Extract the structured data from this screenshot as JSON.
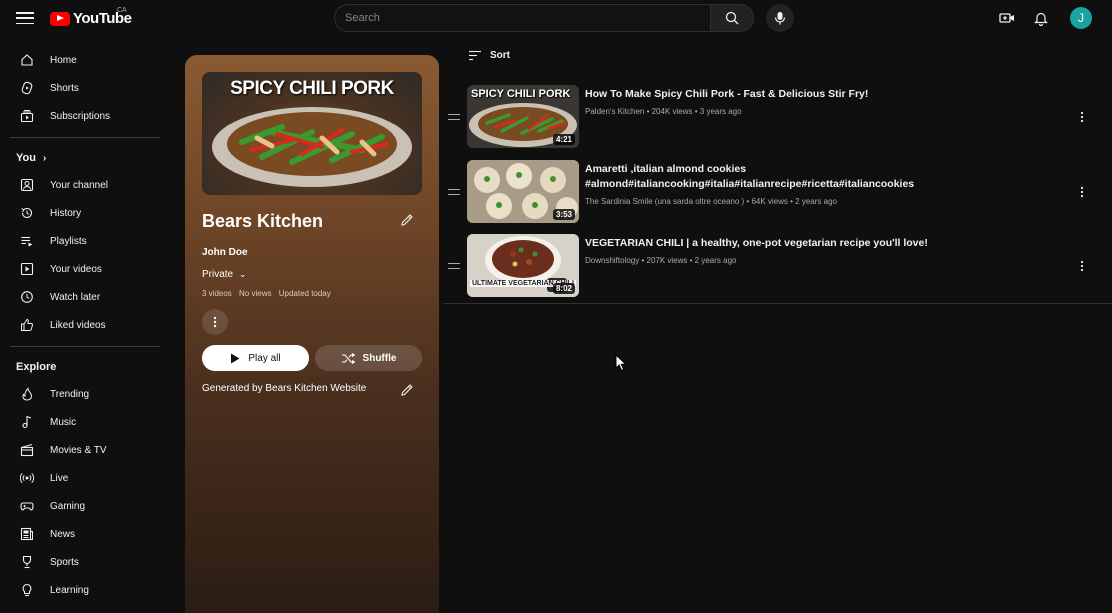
{
  "header": {
    "logo_text": "YouTube",
    "region": "CA",
    "search_placeholder": "Search",
    "avatar_letter": "J"
  },
  "sidebar": {
    "main": [
      {
        "label": "Home",
        "icon": "home-icon"
      },
      {
        "label": "Shorts",
        "icon": "shorts-icon"
      },
      {
        "label": "Subscriptions",
        "icon": "subscriptions-icon"
      }
    ],
    "you_heading": "You",
    "you": [
      {
        "label": "Your channel",
        "icon": "channel-icon"
      },
      {
        "label": "History",
        "icon": "history-icon"
      },
      {
        "label": "Playlists",
        "icon": "playlists-icon"
      },
      {
        "label": "Your videos",
        "icon": "your-videos-icon"
      },
      {
        "label": "Watch later",
        "icon": "watch-later-icon"
      },
      {
        "label": "Liked videos",
        "icon": "liked-icon"
      }
    ],
    "explore_heading": "Explore",
    "explore": [
      {
        "label": "Trending",
        "icon": "trending-icon"
      },
      {
        "label": "Music",
        "icon": "music-icon"
      },
      {
        "label": "Movies & TV",
        "icon": "movies-icon"
      },
      {
        "label": "Live",
        "icon": "live-icon"
      },
      {
        "label": "Gaming",
        "icon": "gaming-icon"
      },
      {
        "label": "News",
        "icon": "news-icon"
      },
      {
        "label": "Sports",
        "icon": "sports-icon"
      },
      {
        "label": "Learning",
        "icon": "learning-icon"
      }
    ]
  },
  "playlist": {
    "thumb_caption": "SPICY CHILI PORK",
    "title": "Bears Kitchen",
    "owner": "John Doe",
    "privacy": "Private",
    "video_count": "3 videos",
    "views": "No views",
    "updated": "Updated today",
    "play_all": "Play all",
    "shuffle": "Shuffle",
    "description": "Generated by Bears Kitchen Website"
  },
  "sort_label": "Sort",
  "videos": [
    {
      "thumb_text": "SPICY CHILI PORK",
      "duration": "4:21",
      "title": "How To Make Spicy Chili Pork - Fast & Delicious Stir Fry!",
      "channel": "Palden's Kitchen",
      "views": "204K views",
      "age": "3 years ago"
    },
    {
      "thumb_text": "",
      "duration": "3:53",
      "title": "Amaretti ,italian almond cookies #almond#italiancooking#italia#italianrecipe#ricetta#italiancookies",
      "channel": "The Sardinia Smile (una sarda oltre  oceano )",
      "views": "64K views",
      "age": "2 years ago"
    },
    {
      "thumb_text": "ULTIMATE VEGETARIAN CHILI",
      "duration": "8:02",
      "title": "VEGETARIAN CHILI | a healthy, one-pot vegetarian recipe you'll love!",
      "channel": "Downshiftology",
      "views": "207K views",
      "age": "2 years ago"
    }
  ],
  "colors": {
    "background": "#0f0f0f",
    "brand_red": "#ff0000",
    "avatar": "#1aa3a3",
    "panel_top": "#8a5a33"
  }
}
